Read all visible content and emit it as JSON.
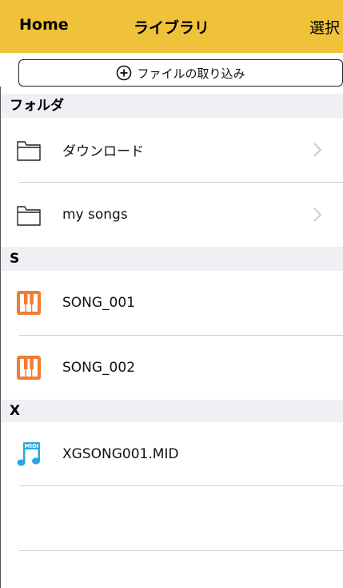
{
  "navbar": {
    "home_label": "Home",
    "title": "ライブラリ",
    "select_label": "選択",
    "background": "#f0c23a"
  },
  "import_button": {
    "label": "ファイルの取り込み",
    "icon": "plus-circle-icon"
  },
  "sections": {
    "folders": "フォルダ",
    "s": "S",
    "x": "X"
  },
  "folders": [
    {
      "label": "ダウンロード",
      "icon": "folder-icon"
    },
    {
      "label": "my songs",
      "icon": "folder-icon"
    }
  ],
  "songs_s": [
    {
      "label": "SONG_001",
      "icon": "piano-icon",
      "color": "#f07d32"
    },
    {
      "label": "SONG_002",
      "icon": "piano-icon",
      "color": "#f07d32"
    }
  ],
  "songs_x": [
    {
      "label": "XGSONG001.MID",
      "icon": "midi-note-icon",
      "color": "#2aa7e0"
    }
  ]
}
